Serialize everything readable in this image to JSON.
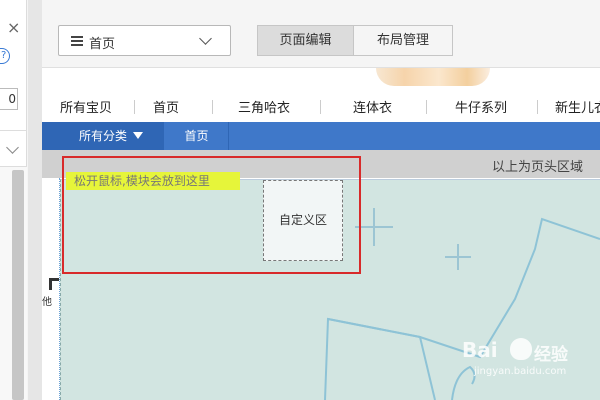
{
  "left_panel": {
    "close_label": "×",
    "help_label": "?",
    "input_value": "0"
  },
  "toolbar": {
    "page_select_value": "首页",
    "tabs": [
      {
        "label": "页面编辑",
        "active": true
      },
      {
        "label": "布局管理",
        "active": false
      }
    ]
  },
  "shop_header": {
    "categories": [
      "所有宝贝",
      "首页",
      "三角哈衣",
      "连体衣",
      "牛仔系列",
      "新生儿衣"
    ],
    "nav_all_label": "所有分类",
    "nav_home_label": "首页",
    "nav_color": "#3f78c9"
  },
  "editor": {
    "header_area_label": "以上为页头区域",
    "drop_hint": "松开鼠标,模块会放到这里",
    "custom_block_label": "自定义区",
    "strip_char": "他",
    "drop_area_color": "#d2e5e1",
    "highlight_color": "#d82a2a"
  },
  "watermark": {
    "logo": "Bai",
    "brand": "经验",
    "url": "jingyan.baidu.com"
  }
}
